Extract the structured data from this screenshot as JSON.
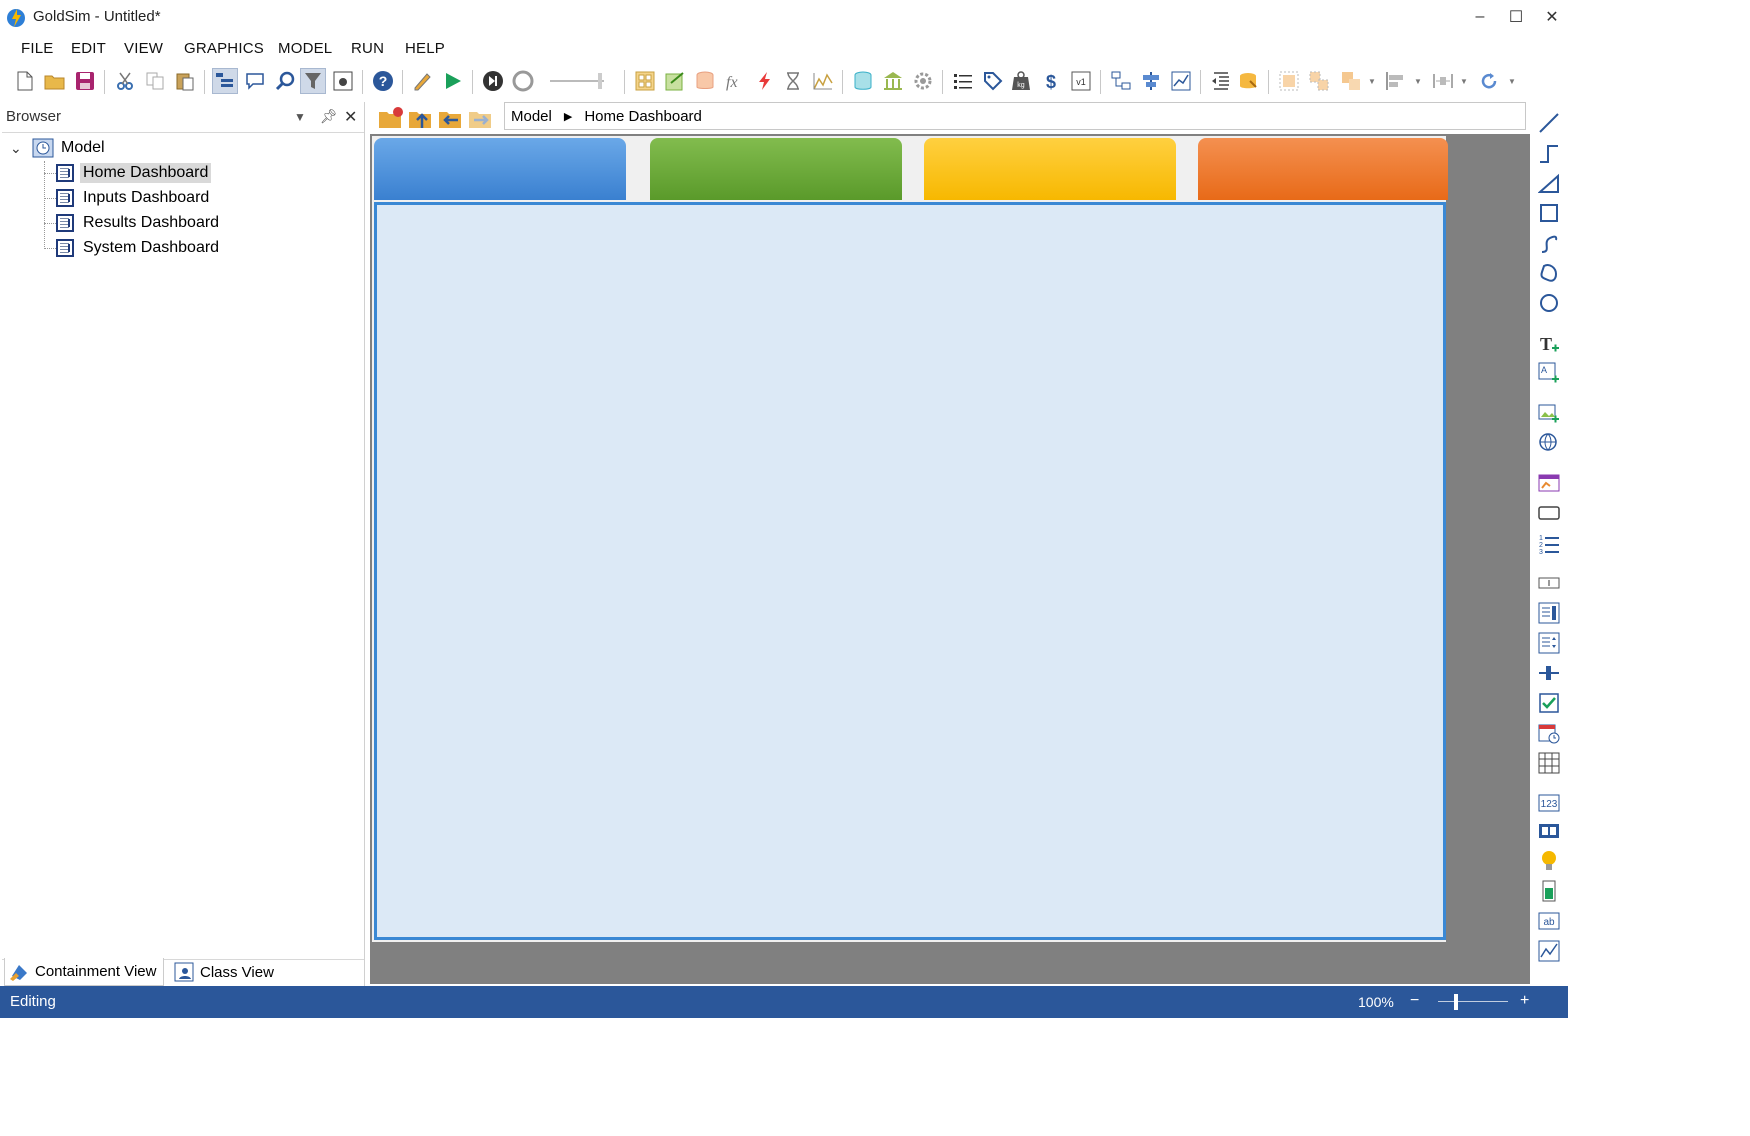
{
  "window": {
    "title": "GoldSim  - Untitled*",
    "minimize_label": "–",
    "maximize_label": "☐",
    "close_label": "✕"
  },
  "menu": [
    "FILE",
    "EDIT",
    "VIEW",
    "GRAPHICS",
    "MODEL",
    "RUN",
    "HELP"
  ],
  "browser": {
    "header": "Browser",
    "tree": {
      "root": "Model",
      "children": [
        "Home Dashboard",
        "Inputs Dashboard",
        "Results Dashboard",
        "System Dashboard"
      ],
      "selected": "Home Dashboard"
    },
    "tabs": [
      "Containment View",
      "Class View"
    ]
  },
  "breadcrumb": [
    "Model",
    "Home Dashboard"
  ],
  "dashboard": {
    "tab_colors": [
      "#4a90d9",
      "#6aab3a",
      "#f7bf16",
      "#ee7428"
    ],
    "panel_color": "#dce9f6",
    "panel_border": "#3a88d4"
  },
  "status": {
    "mode": "Editing",
    "zoom": "100%"
  },
  "colors": {
    "status_bar": "#2b579a",
    "canvas_background": "#808080"
  }
}
